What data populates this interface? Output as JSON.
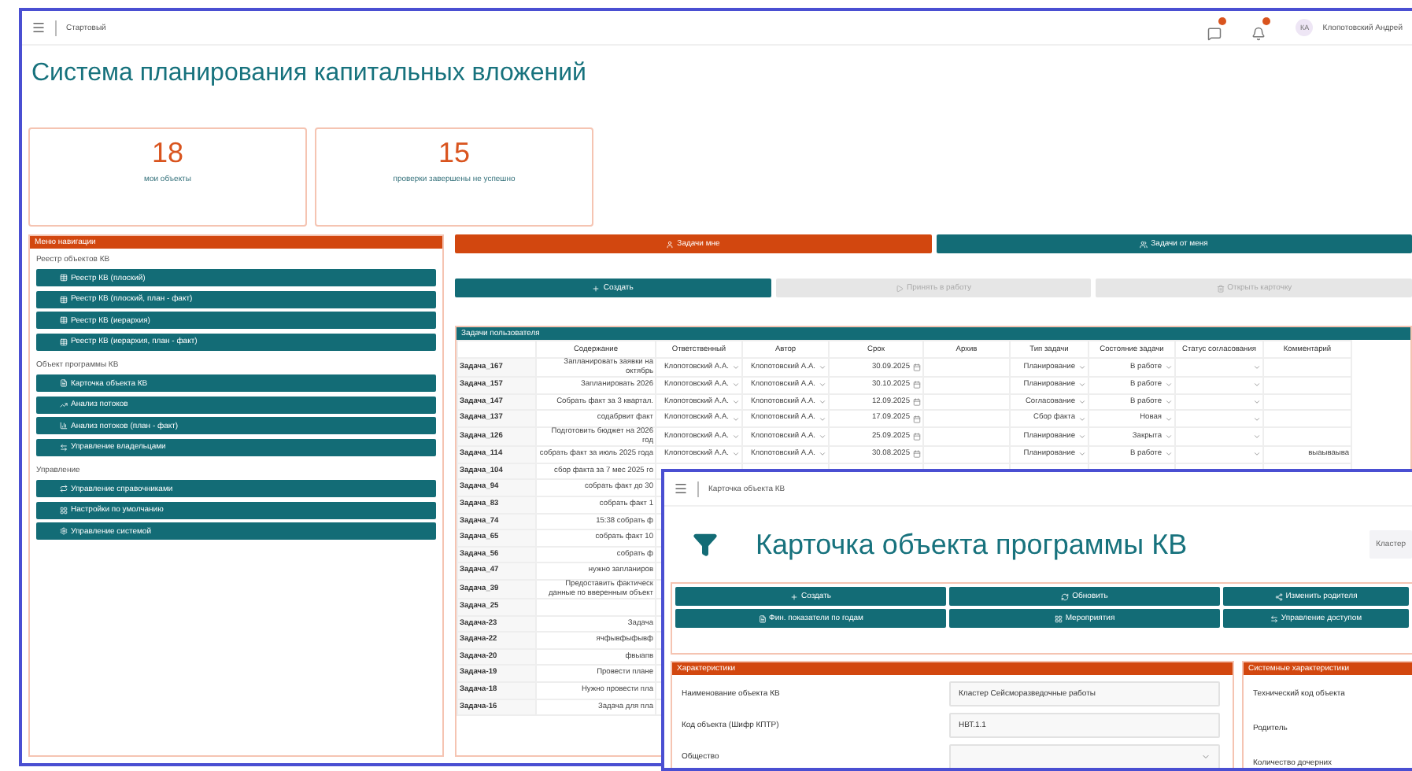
{
  "main_window": {
    "breadcrumb": "Стартовый",
    "user": {
      "initials": "КА",
      "name": "Клопотовский Андрей"
    },
    "title": "Система планирования капитальных вложений",
    "stats": [
      {
        "value": "18",
        "label": "мои объекты"
      },
      {
        "value": "15",
        "label": "проверки завершены не успешно"
      }
    ],
    "nav_menu": {
      "title": "Меню навигации",
      "sections": [
        {
          "title": "Реестр объектов КВ",
          "items": [
            "Реестр КВ (плоский)",
            "Реестр КВ (плоский, план - факт)",
            "Реестр КВ (иерархия)",
            "Реестр КВ (иерархия, план - факт)"
          ]
        },
        {
          "title": "Объект программы КВ",
          "items": [
            "Карточка объекта КВ",
            "Анализ потоков",
            "Анализ потоков (план - факт)",
            "Управление владельцами"
          ]
        },
        {
          "title": "Управление",
          "items": [
            "Управление справочниками",
            "Настройки по умолчанию",
            "Управление системой"
          ]
        }
      ]
    },
    "task_tabs": [
      {
        "label": "Задачи мне",
        "selected": true
      },
      {
        "label": "Задачи от меня",
        "selected": false
      }
    ],
    "actions": [
      {
        "label": "Создать",
        "disabled": false
      },
      {
        "label": "Принять в работу",
        "disabled": true
      },
      {
        "label": "Открыть карточку",
        "disabled": true
      }
    ],
    "tasks_table": {
      "title": "Задачи пользователя",
      "columns": [
        "Содержание",
        "Ответственный",
        "Автор",
        "Срок",
        "Архив",
        "Тип задачи",
        "Состояние задачи",
        "Статус согласования",
        "Комментарий"
      ],
      "rows": [
        {
          "id": "Задача_167",
          "content": "Запланировать заявки на октябрь",
          "responsible": "Клопотовский А.А.",
          "author": "Клопотовский А.А.",
          "due": "30.09.2025",
          "type": "Планирование",
          "state": "В работе"
        },
        {
          "id": "Задача_157",
          "content": "Запланировать 2026",
          "responsible": "Клопотовский А.А.",
          "author": "Клопотовский А.А.",
          "due": "30.10.2025",
          "type": "Планирование",
          "state": "В работе"
        },
        {
          "id": "Задача_147",
          "content": "Собрать факт за 3 квартал.",
          "responsible": "Клопотовский А.А.",
          "author": "Клопотовский А.А.",
          "due": "12.09.2025",
          "type": "Согласование",
          "state": "В работе"
        },
        {
          "id": "Задача_137",
          "content": "содабрвит факт",
          "responsible": "Клопотовский А.А.",
          "author": "Клопотовский А.А.",
          "due": "17.09.2025",
          "type": "Сбор факта",
          "state": "Новая"
        },
        {
          "id": "Задача_126",
          "content": "Подготовить бюджет на 2026 год",
          "responsible": "Клопотовский А.А.",
          "author": "Клопотовский А.А.",
          "due": "25.09.2025",
          "type": "Планирование",
          "state": "Закрыта"
        },
        {
          "id": "Задача_114",
          "content": "собрать факт за июль 2025 года",
          "responsible": "Клопотовский А.А.",
          "author": "Клопотовский А.А.",
          "due": "30.08.2025",
          "type": "Планирование",
          "state": "В работе",
          "comment": "выаываыва"
        },
        {
          "id": "Задача_104",
          "content": "сбор факта за 7 мес 2025 го"
        },
        {
          "id": "Задача_94",
          "content": "собрать факт до 30"
        },
        {
          "id": "Задача_83",
          "content": "собрать факт 1"
        },
        {
          "id": "Задача_74",
          "content": "15:38 собрать ф"
        },
        {
          "id": "Задача_65",
          "content": "собрать факт 10"
        },
        {
          "id": "Задача_56",
          "content": "собрать ф"
        },
        {
          "id": "Задача_47",
          "content": "нужно запланиров"
        },
        {
          "id": "Задача_39",
          "content": "Предоставить фактическ данные по вверенным объект"
        },
        {
          "id": "Задача_25"
        },
        {
          "id": "Задача-23",
          "content": "Задача"
        },
        {
          "id": "Задача-22",
          "content": "ячфывфыфывф"
        },
        {
          "id": "Задача-20",
          "content": "фвыапв"
        },
        {
          "id": "Задача-19",
          "content": "Провести плане"
        },
        {
          "id": "Задача-18",
          "content": "Нужно провести пла"
        },
        {
          "id": "Задача-16",
          "content": "Задача для пла"
        }
      ]
    }
  },
  "card_window": {
    "breadcrumb": "Карточка объекта КВ",
    "title": "Карточка объекта программы КВ",
    "chip": "Кластер",
    "buttons": [
      "Создать",
      "Обновить",
      "Изменить родителя",
      "Фин. показатели по годам",
      "Мероприятия",
      "Управление доступом"
    ],
    "characteristics": {
      "title": "Характеристики",
      "fields": [
        {
          "label": "Наименование объекта КВ",
          "kind": "text",
          "value": "Кластер Сейсморазведочные работы"
        },
        {
          "label": "Код объекта (Шифр КПТР)",
          "kind": "text",
          "value": "НВТ.1.1"
        },
        {
          "label": "Общество",
          "kind": "select"
        }
      ]
    },
    "system": {
      "title": "Системные характеристики",
      "fields": [
        "Технический код объекта",
        "Родитель",
        "Количество дочерних"
      ]
    }
  }
}
